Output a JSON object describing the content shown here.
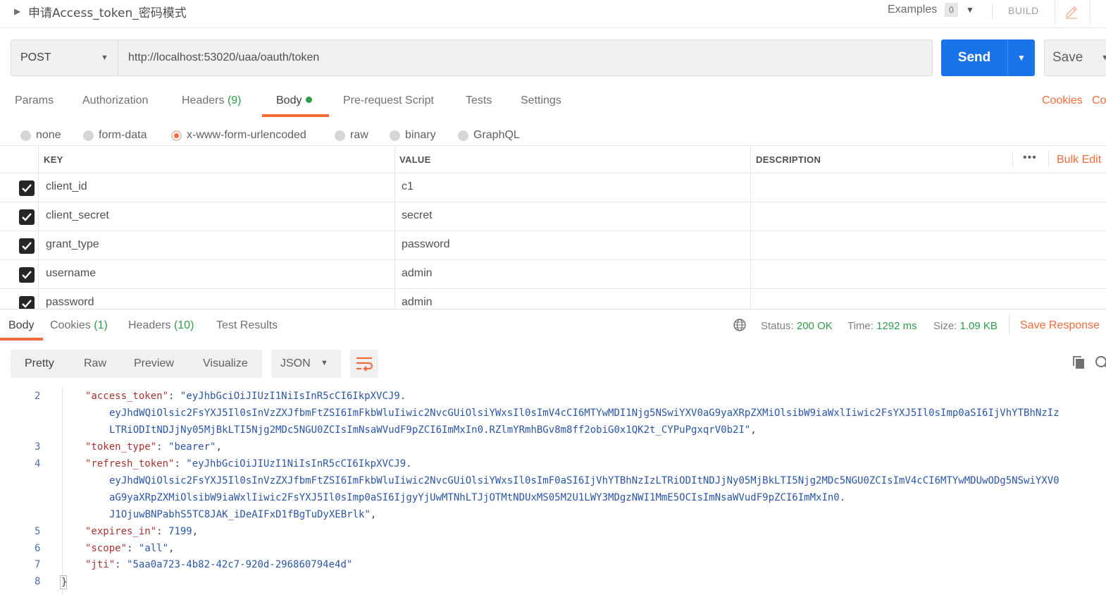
{
  "header": {
    "title": "申请Access_token_密码模式",
    "examples_label": "Examples",
    "examples_count": "0",
    "build_label": "BUILD"
  },
  "request": {
    "method": "POST",
    "url": "http://localhost:53020/uaa/oauth/token",
    "send_label": "Send",
    "save_label": "Save"
  },
  "request_tabs": {
    "params": "Params",
    "authorization": "Authorization",
    "headers": "Headers",
    "headers_count": "(9)",
    "body": "Body",
    "prerequest": "Pre-request Script",
    "tests": "Tests",
    "settings": "Settings",
    "cookies": "Cookies",
    "code": "Co"
  },
  "body_types": {
    "none": "none",
    "form_data": "form-data",
    "urlencoded": "x-www-form-urlencoded",
    "raw": "raw",
    "binary": "binary",
    "graphql": "GraphQL",
    "selected": "x-www-form-urlencoded"
  },
  "params_table": {
    "col_key": "KEY",
    "col_value": "VALUE",
    "col_description": "DESCRIPTION",
    "more": "•••",
    "bulk_edit": "Bulk Edit",
    "rows": [
      {
        "key": "client_id",
        "value": "c1",
        "checked": true
      },
      {
        "key": "client_secret",
        "value": "secret",
        "checked": true
      },
      {
        "key": "grant_type",
        "value": "password",
        "checked": true
      },
      {
        "key": "username",
        "value": "admin",
        "checked": true
      },
      {
        "key": "password",
        "value": "admin",
        "checked": true
      }
    ]
  },
  "response": {
    "tabs": {
      "body": "Body",
      "cookies": "Cookies",
      "cookies_count": "(1)",
      "headers": "Headers",
      "headers_count": "(10)",
      "test_results": "Test Results"
    },
    "status_label": "Status:",
    "status_value": "200 OK",
    "time_label": "Time:",
    "time_value": "1292 ms",
    "size_label": "Size:",
    "size_value": "1.09 KB",
    "save_response": "Save Response",
    "formats": {
      "pretty": "Pretty",
      "raw": "Raw",
      "preview": "Preview",
      "visualize": "Visualize"
    },
    "language": "JSON"
  },
  "json_body": {
    "line_numbers": [
      "2",
      "3",
      "4",
      "5",
      "6",
      "7",
      "8"
    ],
    "access_token_key": "\"access_token\"",
    "access_token_1": "\"eyJhbGciOiJIUzI1NiIsInR5cCI6IkpXVCJ9.",
    "access_token_2": "eyJhdWQiOlsic2FsYXJ5Il0sInVzZXJfbmFtZSI6ImFkbWluIiwic2NvcGUiOlsiYWxsIl0sImV4cCI6MTYwMDI1Njg5NSwiYXV0aG9yaXRpZXMiOlsibW9iaWxlIiwic2FsYXJ5Il0sImp0aSI6IjVhYTBhNzIz",
    "access_token_3": "LTRiODItNDJjNy05MjBkLTI5Njg2MDc5NGU0ZCIsImNsaWVudF9pZCI6ImMxIn0.RZlmYRmhBGv8m8ff2obiG0x1QK2t_CYPuPgxqrV0b2I\"",
    "token_type_key": "\"token_type\"",
    "token_type_value": "\"bearer\"",
    "refresh_token_key": "\"refresh_token\"",
    "refresh_token_1": "\"eyJhbGciOiJIUzI1NiIsInR5cCI6IkpXVCJ9.",
    "refresh_token_2": "eyJhdWQiOlsic2FsYXJ5Il0sInVzZXJfbmFtZSI6ImFkbWluIiwic2NvcGUiOlsiYWxsIl0sImF0aSI6IjVhYTBhNzIzLTRiODItNDJjNy05MjBkLTI5Njg2MDc5NGU0ZCIsImV4cCI6MTYwMDUwODg5NSwiYXV0",
    "refresh_token_3": "aG9yaXRpZXMiOlsibW9iaWxlIiwic2FsYXJ5Il0sImp0aSI6IjgyYjUwMTNhLTJjOTMtNDUxMS05M2U1LWY3MDgzNWI1MmE5OCIsImNsaWVudF9pZCI6ImMxIn0.",
    "refresh_token_4": "J1OjuwBNPabhS5TC8JAK_iDeAIFxD1fBgTuDyXEBrlk\"",
    "expires_in_key": "\"expires_in\"",
    "expires_in_value": "7199",
    "scope_key": "\"scope\"",
    "scope_value": "\"all\"",
    "jti_key": "\"jti\"",
    "jti_value": "\"5aa0a723-4b82-42c7-920d-296860794e4d\"",
    "closing_brace": "}"
  },
  "colors": {
    "accent": "#f26b3a",
    "primary": "#1a73e8",
    "success": "#2e9b4b",
    "json_key": "#a8322f",
    "json_string": "#2b55a6"
  }
}
